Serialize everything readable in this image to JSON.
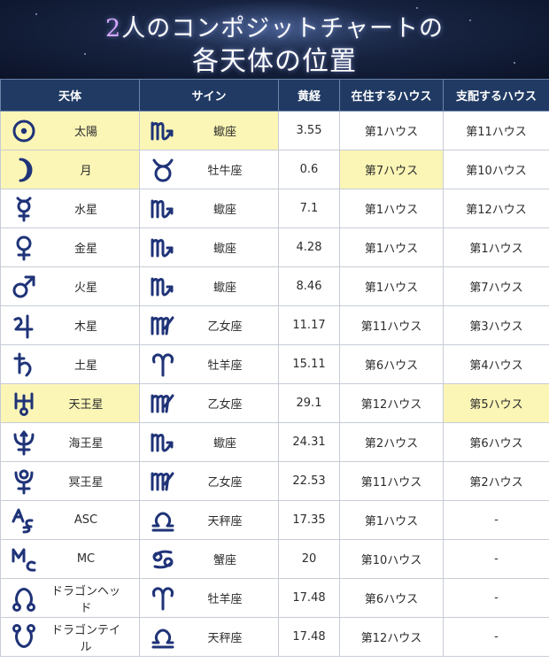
{
  "banner": {
    "title_number": "2",
    "title_line1": "人のコンポジットチャートの",
    "title_line2": "各天体の位置"
  },
  "table": {
    "headers": {
      "body": "天体",
      "sign": "サイン",
      "longitude": "黄経",
      "house_in": "在住するハウス",
      "house_rules": "支配するハウス"
    },
    "rows": [
      {
        "body": "太陽",
        "body_icon": "sun-icon",
        "sign": "蠍座",
        "sign_icon": "scorpio-icon",
        "longitude": "3.55",
        "house_in": "第1ハウス",
        "house_rules": "第11ハウス"
      },
      {
        "body": "月",
        "body_icon": "moon-icon",
        "sign": "牡牛座",
        "sign_icon": "taurus-icon",
        "longitude": "0.6",
        "house_in": "第7ハウス",
        "house_rules": "第10ハウス"
      },
      {
        "body": "水星",
        "body_icon": "mercury-icon",
        "sign": "蠍座",
        "sign_icon": "scorpio-icon",
        "longitude": "7.1",
        "house_in": "第1ハウス",
        "house_rules": "第12ハウス"
      },
      {
        "body": "金星",
        "body_icon": "venus-icon",
        "sign": "蠍座",
        "sign_icon": "scorpio-icon",
        "longitude": "4.28",
        "house_in": "第1ハウス",
        "house_rules": "第1ハウス"
      },
      {
        "body": "火星",
        "body_icon": "mars-icon",
        "sign": "蠍座",
        "sign_icon": "scorpio-icon",
        "longitude": "8.46",
        "house_in": "第1ハウス",
        "house_rules": "第7ハウス"
      },
      {
        "body": "木星",
        "body_icon": "jupiter-icon",
        "sign": "乙女座",
        "sign_icon": "virgo-icon",
        "longitude": "11.17",
        "house_in": "第11ハウス",
        "house_rules": "第3ハウス"
      },
      {
        "body": "土星",
        "body_icon": "saturn-icon",
        "sign": "牡羊座",
        "sign_icon": "aries-icon",
        "longitude": "15.11",
        "house_in": "第6ハウス",
        "house_rules": "第4ハウス"
      },
      {
        "body": "天王星",
        "body_icon": "uranus-icon",
        "sign": "乙女座",
        "sign_icon": "virgo-icon",
        "longitude": "29.1",
        "house_in": "第12ハウス",
        "house_rules": "第5ハウス"
      },
      {
        "body": "海王星",
        "body_icon": "neptune-icon",
        "sign": "蠍座",
        "sign_icon": "scorpio-icon",
        "longitude": "24.31",
        "house_in": "第2ハウス",
        "house_rules": "第6ハウス"
      },
      {
        "body": "冥王星",
        "body_icon": "pluto-icon",
        "sign": "乙女座",
        "sign_icon": "virgo-icon",
        "longitude": "22.53",
        "house_in": "第11ハウス",
        "house_rules": "第2ハウス"
      },
      {
        "body": "ASC",
        "body_icon": "ascendant-icon",
        "sign": "天秤座",
        "sign_icon": "libra-icon",
        "longitude": "17.35",
        "house_in": "第1ハウス",
        "house_rules": "-"
      },
      {
        "body": "MC",
        "body_icon": "midheaven-icon",
        "sign": "蟹座",
        "sign_icon": "cancer-icon",
        "longitude": "20",
        "house_in": "第10ハウス",
        "house_rules": "-"
      },
      {
        "body": "ドラゴンヘッド",
        "body_icon": "dragon-head-icon",
        "sign": "牡羊座",
        "sign_icon": "aries-icon",
        "longitude": "17.48",
        "house_in": "第6ハウス",
        "house_rules": "-"
      },
      {
        "body": "ドラゴンテイル",
        "body_icon": "dragon-tail-icon",
        "sign": "天秤座",
        "sign_icon": "libra-icon",
        "longitude": "17.48",
        "house_in": "第12ハウス",
        "house_rules": "-"
      }
    ]
  },
  "colors": {
    "header_bg": "#203a63",
    "highlight": "#fbf6b6",
    "glyph": "#1f3378",
    "banner_bg": "#0b1328"
  }
}
